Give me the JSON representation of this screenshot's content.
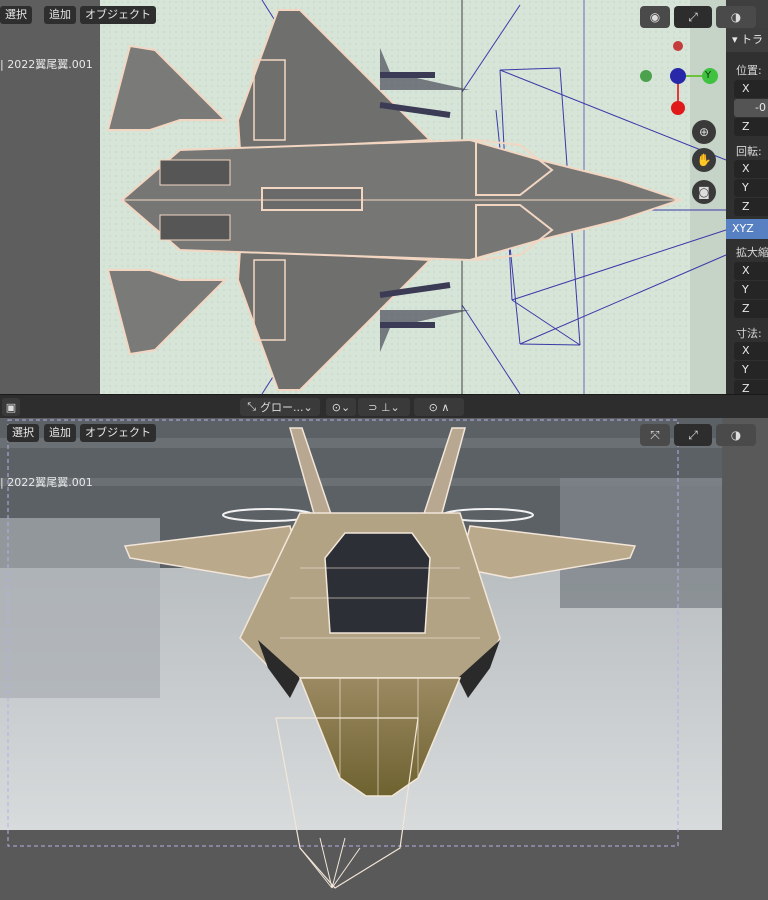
{
  "header_menu": {
    "select": "選択",
    "add": "追加",
    "object": "オブジェクト"
  },
  "object_name": "| 2022翼尾翼.001",
  "properties": {
    "panel_title": "トラ",
    "location_label": "位置:",
    "rotation_label": "回転:",
    "rotation_mode": "XYZ",
    "scale_label": "拡大縮",
    "dimensions_label": "寸法:",
    "x": "X",
    "y": "Y",
    "z": "Z",
    "loc_y_value": "-0"
  },
  "toolbar": {
    "transform_orientation": "グロー...",
    "snap_icon": "magnet-icon",
    "pivot_icon": "pivot-icon"
  },
  "gizmo": {
    "y_label": "Y",
    "colors": {
      "x": "#e03a3a",
      "y": "#6fc240",
      "z": "#2d55d0"
    }
  },
  "icons": {
    "zoom": "zoom-icon",
    "pan": "hand-icon",
    "camera": "camera-icon",
    "view": "eye-icon",
    "transform_gizmo": "gizmo-icon",
    "overlay": "overlay-icon",
    "move_tool": "move-tool-icon"
  }
}
